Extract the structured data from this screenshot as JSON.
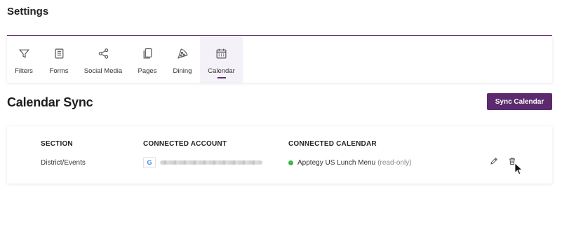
{
  "header": {
    "title": "Settings"
  },
  "tabs": [
    {
      "label": "Filters",
      "icon": "filter-icon"
    },
    {
      "label": "Forms",
      "icon": "document-icon"
    },
    {
      "label": "Social Media",
      "icon": "share-icon"
    },
    {
      "label": "Pages",
      "icon": "pages-icon"
    },
    {
      "label": "Dining",
      "icon": "pizza-icon"
    },
    {
      "label": "Calendar",
      "icon": "calendar-icon",
      "active": true
    }
  ],
  "calendar_sync": {
    "title": "Calendar Sync",
    "sync_button_label": "Sync Calendar",
    "columns": {
      "section": "SECTION",
      "connected_account": "CONNECTED ACCOUNT",
      "connected_calendar": "CONNECTED CALENDAR"
    },
    "rows": [
      {
        "section": "District/Events",
        "account_provider_glyph": "G",
        "calendar_name": "Apptegy US Lunch Menu",
        "calendar_access": "(read-only)",
        "status_color": "#3bb44a"
      }
    ]
  },
  "colors": {
    "accent": "#5c2a6e",
    "active_tab_bg": "#f5f1f8",
    "status_ok": "#3bb44a"
  }
}
